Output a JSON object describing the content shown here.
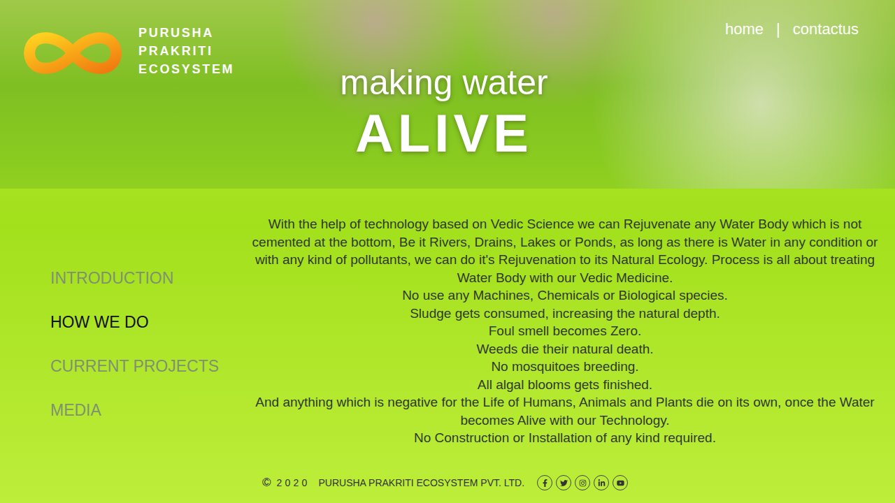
{
  "brand": {
    "lines": [
      "PURUSHA",
      "PRAKRITI",
      "ECOSYSTEM"
    ]
  },
  "nav": {
    "items": [
      {
        "label": "home"
      },
      {
        "label": "contactus"
      }
    ],
    "separator": "|"
  },
  "hero": {
    "subtitle": "making water",
    "title": "ALIVE"
  },
  "sidebar": {
    "items": [
      {
        "label": "INTRODUCTION",
        "selected": false
      },
      {
        "label": "HOW WE DO",
        "selected": true
      },
      {
        "label": "CURRENT PROJECTS",
        "selected": false
      },
      {
        "label": "MEDIA",
        "selected": false
      }
    ]
  },
  "content": {
    "paragraphs": [
      "With the help of technology based on Vedic Science we can Rejuvenate any Water Body which is not cemented at the bottom, Be it Rivers, Drains, Lakes or Ponds, as long as there is Water in any condition or with any kind of pollutants, we can do it's Rejuvenation to its Natural Ecology. Process is all about treating Water Body with our Vedic Medicine.",
      "No use any Machines, Chemicals or Biological species.",
      "Sludge gets consumed, increasing the natural depth.",
      "Foul smell becomes Zero.",
      "Weeds die their natural death.",
      "No mosquitoes breeding.",
      "All algal blooms gets finished.",
      "And anything which is negative for the Life of Humans, Animals and Plants die on its own, once the Water becomes Alive with our Technology.",
      "No Construction or Installation of any kind required."
    ]
  },
  "footer": {
    "symbol": "©",
    "year": "2020",
    "company": "PURUSHA PRAKRITI ECOSYSTEM PVT. LTD."
  }
}
